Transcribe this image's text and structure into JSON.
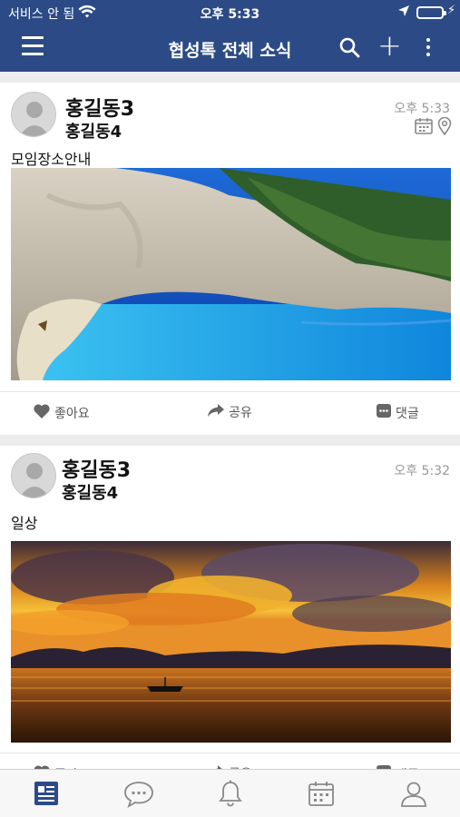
{
  "status": {
    "carrier": "서비스 안 됨",
    "time": "오후 5:33"
  },
  "nav": {
    "title": "협성톡 전체 소식"
  },
  "posts": [
    {
      "name1": "홍길동3",
      "name2": "홍길동4",
      "time": "오후 5:33",
      "caption": "모임장소안내",
      "photo": "coastal-cliff-beach-photo"
    },
    {
      "name1": "홍길동3",
      "name2": "홍길동4",
      "time": "오후 5:32",
      "caption": "일상",
      "photo": "sunset-over-sea-photo"
    }
  ],
  "actions": {
    "like": "좋아요",
    "share": "공유",
    "comment": "댓글"
  },
  "tabs": [
    "news-feed-icon",
    "chat-icon",
    "bell-icon",
    "calendar-icon",
    "profile-icon"
  ],
  "colors": {
    "navbar": "#2c4b86",
    "accent": "#2c4b86"
  }
}
